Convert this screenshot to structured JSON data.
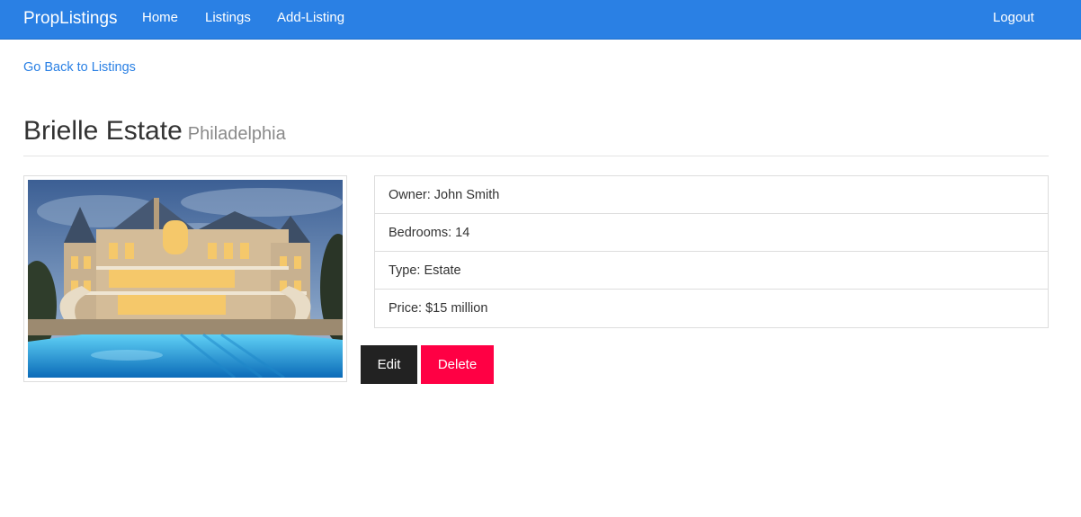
{
  "navbar": {
    "brand": "PropListings",
    "links": [
      "Home",
      "Listings",
      "Add-Listing"
    ],
    "logout": "Logout",
    "color": "#2a80e4"
  },
  "back_link": "Go Back to Listings",
  "listing": {
    "title": "Brielle Estate",
    "city": "Philadelphia",
    "image": "mansion-with-pool-photo",
    "details": [
      "Owner: John Smith",
      "Bedrooms: 14",
      "Type: Estate",
      "Price: $15 million"
    ]
  },
  "actions": {
    "edit": "Edit",
    "delete": "Delete",
    "edit_color": "#222222",
    "delete_color": "#ff0044"
  }
}
